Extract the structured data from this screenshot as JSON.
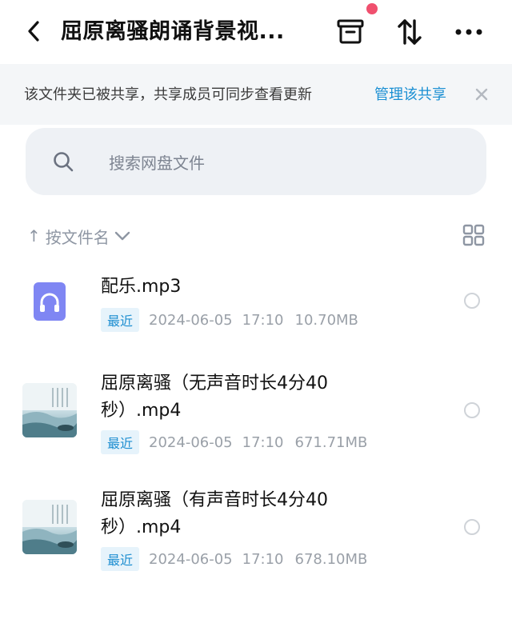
{
  "header": {
    "title": "屈原离骚朗诵背景视...",
    "icons": [
      "back-arrow-icon",
      "archive-box-icon",
      "sort-transfer-icon",
      "more-dots-icon"
    ],
    "accent_dot_color": "#f0506e"
  },
  "banner": {
    "text": "该文件夹已被共享，共享成员可同步查看更新",
    "link": "管理该共享",
    "link_color": "#1a8fd3"
  },
  "search": {
    "placeholder": "搜索网盘文件"
  },
  "sort": {
    "arrow": "↑",
    "label": "按文件名"
  },
  "files": [
    {
      "name_line1": "配乐.mp3",
      "name_line2": "",
      "tag": "最近",
      "date": "2024-06-05",
      "time": "17:10",
      "size": "10.70MB",
      "icon": "headphones-icon"
    },
    {
      "name_line1": "屈原离骚（无声音时长4分40",
      "name_line2": "秒）.mp4",
      "tag": "最近",
      "date": "2024-06-05",
      "time": "17:10",
      "size": "671.71MB",
      "icon": "video-thumbnail"
    },
    {
      "name_line1": "屈原离骚（有声音时长4分40",
      "name_line2": "秒）.mp4",
      "tag": "最近",
      "date": "2024-06-05",
      "time": "17:10",
      "size": "678.10MB",
      "icon": "video-thumbnail"
    }
  ]
}
